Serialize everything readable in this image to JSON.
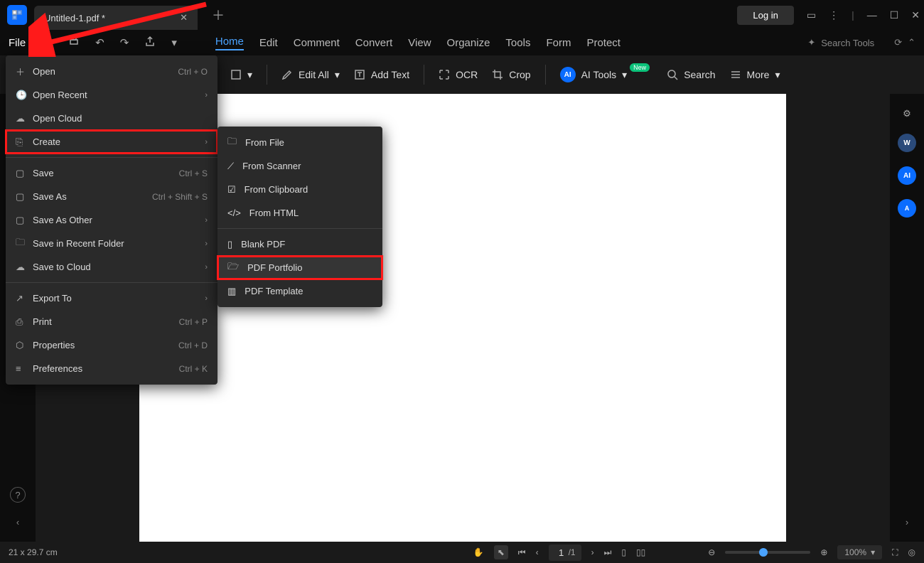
{
  "titlebar": {
    "tab_title": "Untitled-1.pdf *",
    "login": "Log in"
  },
  "menubar": {
    "file": "File",
    "items": [
      "Home",
      "Edit",
      "Comment",
      "Convert",
      "View",
      "Organize",
      "Tools",
      "Form",
      "Protect"
    ],
    "search_placeholder": "Search Tools"
  },
  "ribbon": {
    "edit_all": "Edit All",
    "add_text": "Add Text",
    "ocr": "OCR",
    "crop": "Crop",
    "ai_tools": "AI Tools",
    "ai_badge": "AI",
    "new_badge": "New",
    "search": "Search",
    "more": "More"
  },
  "file_menu": {
    "open": {
      "label": "Open",
      "shortcut": "Ctrl + O"
    },
    "open_recent": {
      "label": "Open Recent"
    },
    "open_cloud": {
      "label": "Open Cloud"
    },
    "create": {
      "label": "Create"
    },
    "save": {
      "label": "Save",
      "shortcut": "Ctrl + S"
    },
    "save_as": {
      "label": "Save As",
      "shortcut": "Ctrl + Shift + S"
    },
    "save_as_other": {
      "label": "Save As Other"
    },
    "save_recent_folder": {
      "label": "Save in Recent Folder"
    },
    "save_cloud": {
      "label": "Save to Cloud"
    },
    "export_to": {
      "label": "Export To"
    },
    "print": {
      "label": "Print",
      "shortcut": "Ctrl + P"
    },
    "properties": {
      "label": "Properties",
      "shortcut": "Ctrl + D"
    },
    "preferences": {
      "label": "Preferences",
      "shortcut": "Ctrl + K"
    }
  },
  "create_submenu": {
    "from_file": "From File",
    "from_scanner": "From Scanner",
    "from_clipboard": "From Clipboard",
    "from_html": "From HTML",
    "blank_pdf": "Blank PDF",
    "pdf_portfolio": "PDF Portfolio",
    "pdf_template": "PDF Template"
  },
  "statusbar": {
    "dimensions": "21 x 29.7 cm",
    "page_current": "1",
    "page_total": "/1",
    "zoom": "100%"
  },
  "right_rail": {
    "ai": "AI",
    "at": "A"
  }
}
